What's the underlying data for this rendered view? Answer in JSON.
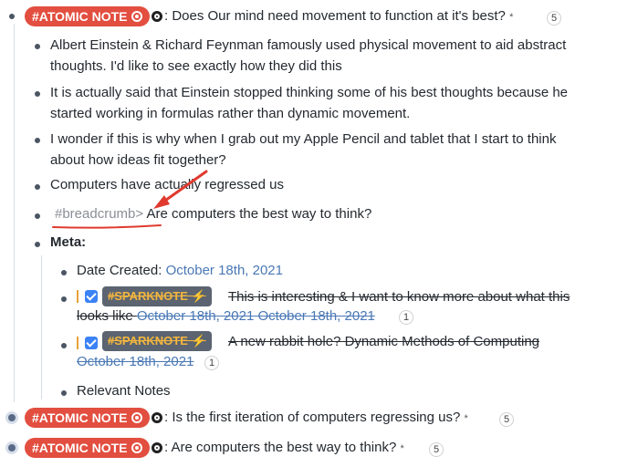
{
  "accent": {
    "atomic_tag": "#e24e3f",
    "spark_tag_bg": "#5b6470",
    "spark_tag_fg": "#f4b63f",
    "link": "#4a78b5",
    "annotation": "#e03a2f"
  },
  "top": {
    "tag": "#ATOMIC NOTE",
    "text": ": Does Our mind need movement to function at it's best?",
    "star": "*",
    "count": "5"
  },
  "children": [
    {
      "lines": [
        "Albert Einstein & Richard Feynman famously used physical movement to aid abstract",
        "thoughts. I'd like to see exactly how they did this"
      ]
    },
    {
      "lines": [
        "It is actually said that Einstein stopped thinking some of his best thoughts because he",
        "started working in formulas rather than dynamic movement."
      ]
    },
    {
      "lines": [
        "I wonder if this is why when I grab out my Apple Pencil and tablet that I start to think",
        "about how ideas fit together?"
      ]
    },
    {
      "lines": [
        "Computers have actually regressed us"
      ]
    }
  ],
  "breadcrumb": {
    "tag": "#breadcrumb>",
    "text": "Are computers the best way to think?"
  },
  "meta": {
    "label": "Meta:",
    "date_label": "Date Created: ",
    "date_value": "October 18th, 2021",
    "spark1": {
      "tag": "#SPARKNOTE ⚡",
      "line1": "This is interesting & I want to know more about what this",
      "line2_prefix": "looks like ",
      "line2_dates": "October 18th, 2021 October 18th, 2021",
      "count": "1"
    },
    "spark2": {
      "tag": "#SPARKNOTE ⚡",
      "line1": "A new rabbit hole? Dynamic Methods of Computing",
      "line2_dates": "October 18th, 2021",
      "count": "1"
    },
    "relevant": "Relevant Notes"
  },
  "siblings": [
    {
      "tag": "#ATOMIC NOTE",
      "text": ": Is the first iteration of computers regressing us?",
      "star": "*",
      "count": "5"
    },
    {
      "tag": "#ATOMIC NOTE",
      "text": ": Are computers the best way to think?",
      "star": "*",
      "count": "5"
    }
  ]
}
